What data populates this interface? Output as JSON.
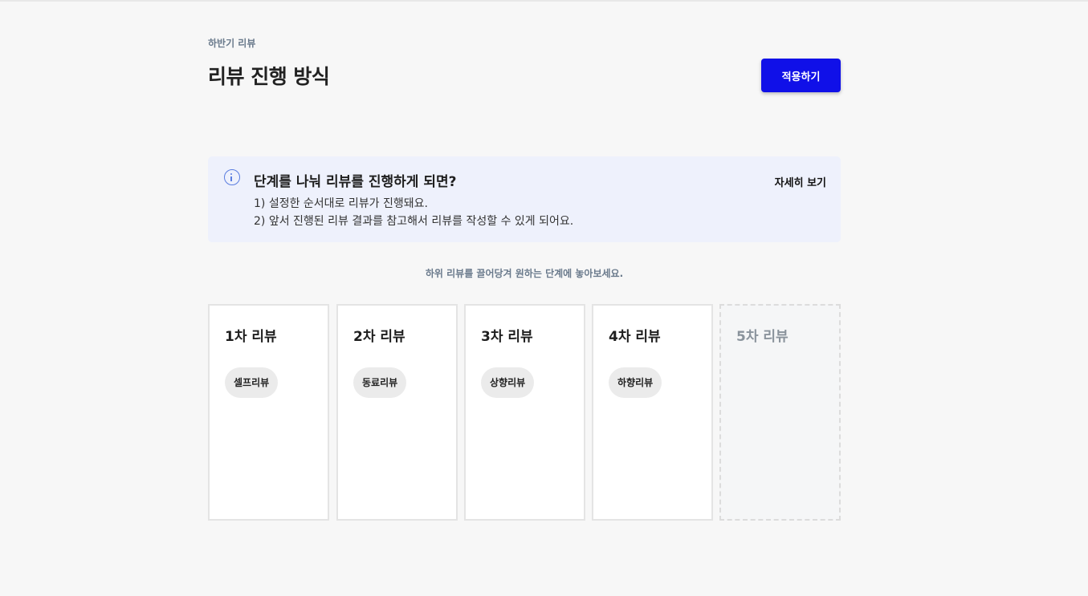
{
  "header": {
    "eyebrow": "하반기 리뷰",
    "title": "리뷰 진행 방식",
    "apply_label": "적용하기"
  },
  "info": {
    "icon": "info-circle-icon",
    "title": "단계를 나눠 리뷰를 진행하게 되면?",
    "line1": "1) 설정한 순서대로 리뷰가 진행돼요.",
    "line2": "2) 앞서 진행된 리뷰 결과를 참고해서 리뷰를 작성할 수 있게 되어요.",
    "detail_label": "자세히 보기"
  },
  "hint": "하위 리뷰를 끌어당겨 원하는 단계에 놓아보세요.",
  "stages": [
    {
      "title": "1차 리뷰",
      "chip": "셀프리뷰"
    },
    {
      "title": "2차 리뷰",
      "chip": "동료리뷰"
    },
    {
      "title": "3차 리뷰",
      "chip": "상향리뷰"
    },
    {
      "title": "4차 리뷰",
      "chip": "하향리뷰"
    },
    {
      "title": "5차 리뷰"
    }
  ],
  "colors": {
    "accent": "#1010e8",
    "info_bg": "#eef1fc",
    "info_icon": "#5a7de0",
    "muted": "#6a7a8c"
  }
}
